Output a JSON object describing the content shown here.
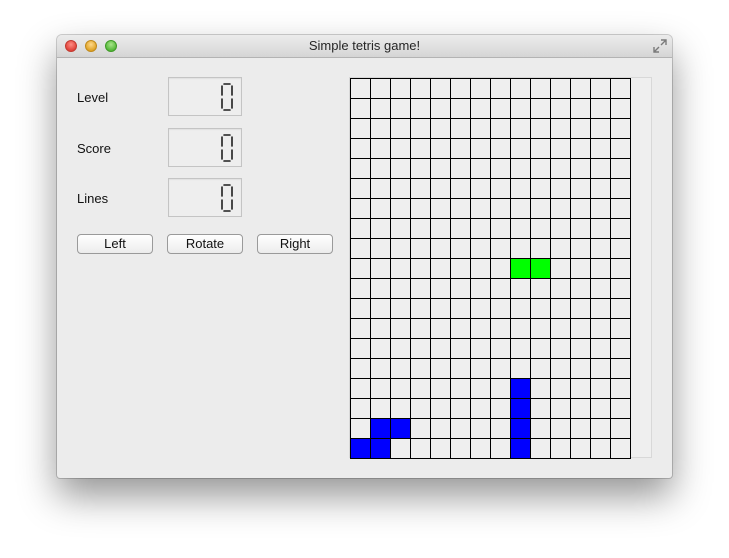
{
  "window": {
    "title": "Simple tetris game!"
  },
  "stats": [
    {
      "key": "level",
      "label": "Level",
      "value": "0"
    },
    {
      "key": "score",
      "label": "Score",
      "value": "0"
    },
    {
      "key": "lines",
      "label": "Lines",
      "value": "0"
    }
  ],
  "buttons": {
    "left": "Left",
    "rotate": "Rotate",
    "right": "Right"
  },
  "board": {
    "columns": 14,
    "rows": 19,
    "empty_color": "#efefef",
    "filled_cells": [
      {
        "col": 8,
        "row": 9,
        "color": "#00ff00"
      },
      {
        "col": 9,
        "row": 9,
        "color": "#00ff00"
      },
      {
        "col": 8,
        "row": 15,
        "color": "#0000ff"
      },
      {
        "col": 8,
        "row": 16,
        "color": "#0000ff"
      },
      {
        "col": 8,
        "row": 17,
        "color": "#0000ff"
      },
      {
        "col": 8,
        "row": 18,
        "color": "#0000ff"
      },
      {
        "col": 1,
        "row": 17,
        "color": "#0000ff"
      },
      {
        "col": 2,
        "row": 17,
        "color": "#0000ff"
      },
      {
        "col": 0,
        "row": 18,
        "color": "#0000ff"
      },
      {
        "col": 1,
        "row": 18,
        "color": "#0000ff"
      }
    ]
  }
}
